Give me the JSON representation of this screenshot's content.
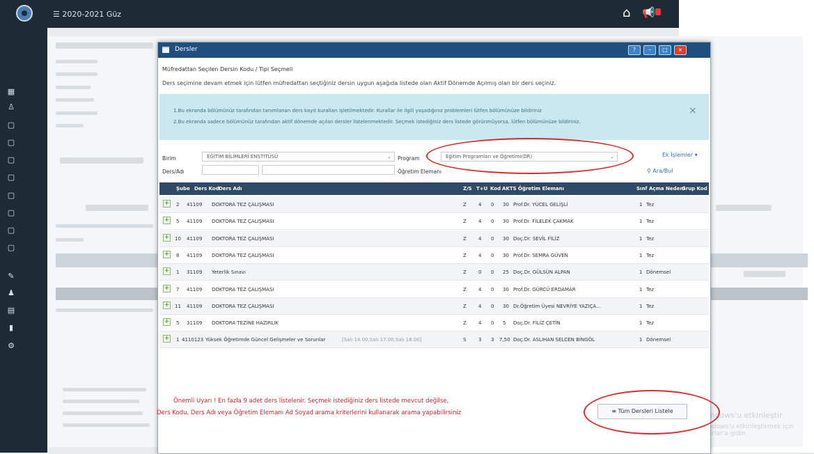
{
  "topbar": {
    "term_label": "2020-2021 Güz"
  },
  "modal": {
    "title": "Dersler",
    "subtitle": "Müfredattan Seçilen Dersin Kodu / Tipi Seçmeli",
    "description": "Ders seçimine devam etmek için lütfen müfredattan seçtiğiniz dersin uygun aşağıda listede olan Aktif Dönemde Açılmış olan bir ders seçiniz.",
    "info_line1": "1.Bu ekranda bölümünüz tarafından tanımlanan ders kayıt kuralları işletilmektedir. Kurallar ile ilgili yaşadığınız problemleri lütfen bölümünüze bildiriniz",
    "info_line2": "2.Bu ekranda sadece bölümünüz tarafından aktif dönemde açılan dersler listelenmektedir. Seçmek istediğiniz ders listede görünmüyorsa, lütfen bölümünüze bildiriniz."
  },
  "filters": {
    "birim_label": "Birim",
    "birim_value": "EĞİTİM BİLİMLERİ ENSTİTÜSÜ",
    "program_label": "Program",
    "program_value": "Eğitim Programları ve Öğretimi(DR)",
    "ders_label": "Ders/Adı",
    "ogretim_label": "Öğretim Elemanı",
    "ek_islemler": "Ek İşlemler ▾",
    "ara_bul": "Ara/Bul"
  },
  "table": {
    "headers": [
      "Şube",
      "Ders Kod",
      "Ders Adı",
      "Z/S",
      "T+U",
      "Kod",
      "AKTS",
      "Öğretim Elemanı",
      "Sınf",
      "Açma Nedeni",
      "Grup Kod"
    ],
    "rows": [
      {
        "sube": "2",
        "kod": "41109",
        "ad": "DOKTORA TEZ ÇALIŞMASI",
        "zs": "Z",
        "tu": "4",
        "k": "0",
        "akts": "30",
        "ogretim": "Prof.Dr. YÜCEL GELİŞLİ",
        "sinif": "1",
        "neden": "Tez"
      },
      {
        "sube": "5",
        "kod": "41109",
        "ad": "DOKTORA TEZ ÇALIŞMASI",
        "zs": "Z",
        "tu": "4",
        "k": "0",
        "akts": "30",
        "ogretim": "Prof.Dr. FİLELEK ÇAKMAK",
        "sinif": "1",
        "neden": "Tez"
      },
      {
        "sube": "10",
        "kod": "41109",
        "ad": "DOKTORA TEZ ÇALIŞMASI",
        "zs": "Z",
        "tu": "4",
        "k": "0",
        "akts": "30",
        "ogretim": "Doç.Dr. SEVİL FİLİZ",
        "sinif": "1",
        "neden": "Tez"
      },
      {
        "sube": "8",
        "kod": "41109",
        "ad": "DOKTORA TEZ ÇALIŞMASI",
        "zs": "Z",
        "tu": "4",
        "k": "0",
        "akts": "30",
        "ogretim": "Prof.Dr. SEMRA GÜVEN",
        "sinif": "1",
        "neden": "Tez"
      },
      {
        "sube": "1",
        "kod": "31109",
        "ad": "Yeterlik Sınavı",
        "zs": "Z",
        "tu": "0",
        "k": "0",
        "akts": "25",
        "ogretim": "Doç.Dr. GÜLSÜN ALPAN",
        "sinif": "1",
        "neden": "Dönemsel"
      },
      {
        "sube": "7",
        "kod": "41109",
        "ad": "DOKTORA TEZ ÇALIŞMASI",
        "zs": "Z",
        "tu": "4",
        "k": "0",
        "akts": "30",
        "ogretim": "Prof.Dr. GÜRCÜ ERDAMAR",
        "sinif": "1",
        "neden": "Tez"
      },
      {
        "sube": "11",
        "kod": "41109",
        "ad": "DOKTORA TEZ ÇALIŞMASI",
        "zs": "Z",
        "tu": "4",
        "k": "0",
        "akts": "30",
        "ogretim": "Dr.Öğretim Üyesi NEVRİYE YAZIÇA...",
        "sinif": "1",
        "neden": "Tez"
      },
      {
        "sube": "5",
        "kod": "31109",
        "ad": "DOKTORA TEZİNE HAZIRLIK",
        "zs": "Z",
        "tu": "4",
        "k": "0",
        "akts": "5",
        "ogretim": "Doç.Dr. FİLİZ ÇETİN",
        "sinif": "1",
        "neden": "Tez"
      },
      {
        "sube": "1",
        "kod": "4110123",
        "ad": "Yüksek Öğretimde Güncel Gelişmeler ve Sorunlar",
        "extra": "[Salı 14.00,Salı 17.00,Salı 18.00]",
        "zs": "S",
        "tu": "3",
        "k": "3",
        "akts": "7,50",
        "ogretim": "Doç.Dr. ASLIHAN SELCEN BİNGÖL",
        "sinif": "1",
        "neden": "Dönemsel"
      }
    ]
  },
  "warning": {
    "line1": "Önemli Uyarı ! En fazla 9 adet ders listelenir. Seçmek istediğiniz ders listede mevcut değilse,",
    "line2": "Ders Kodu, Ders Adı veya Öğretim Elemanı Ad Soyad arama kriterlerini kullanarak arama yapabilirsiniz"
  },
  "buttons": {
    "tum_dersler": "Tüm Dersleri Listele"
  },
  "colors": {
    "annotation": "#d32f2f",
    "titlebar": "#1e4f7e",
    "sidebar": "#1c2b36"
  }
}
